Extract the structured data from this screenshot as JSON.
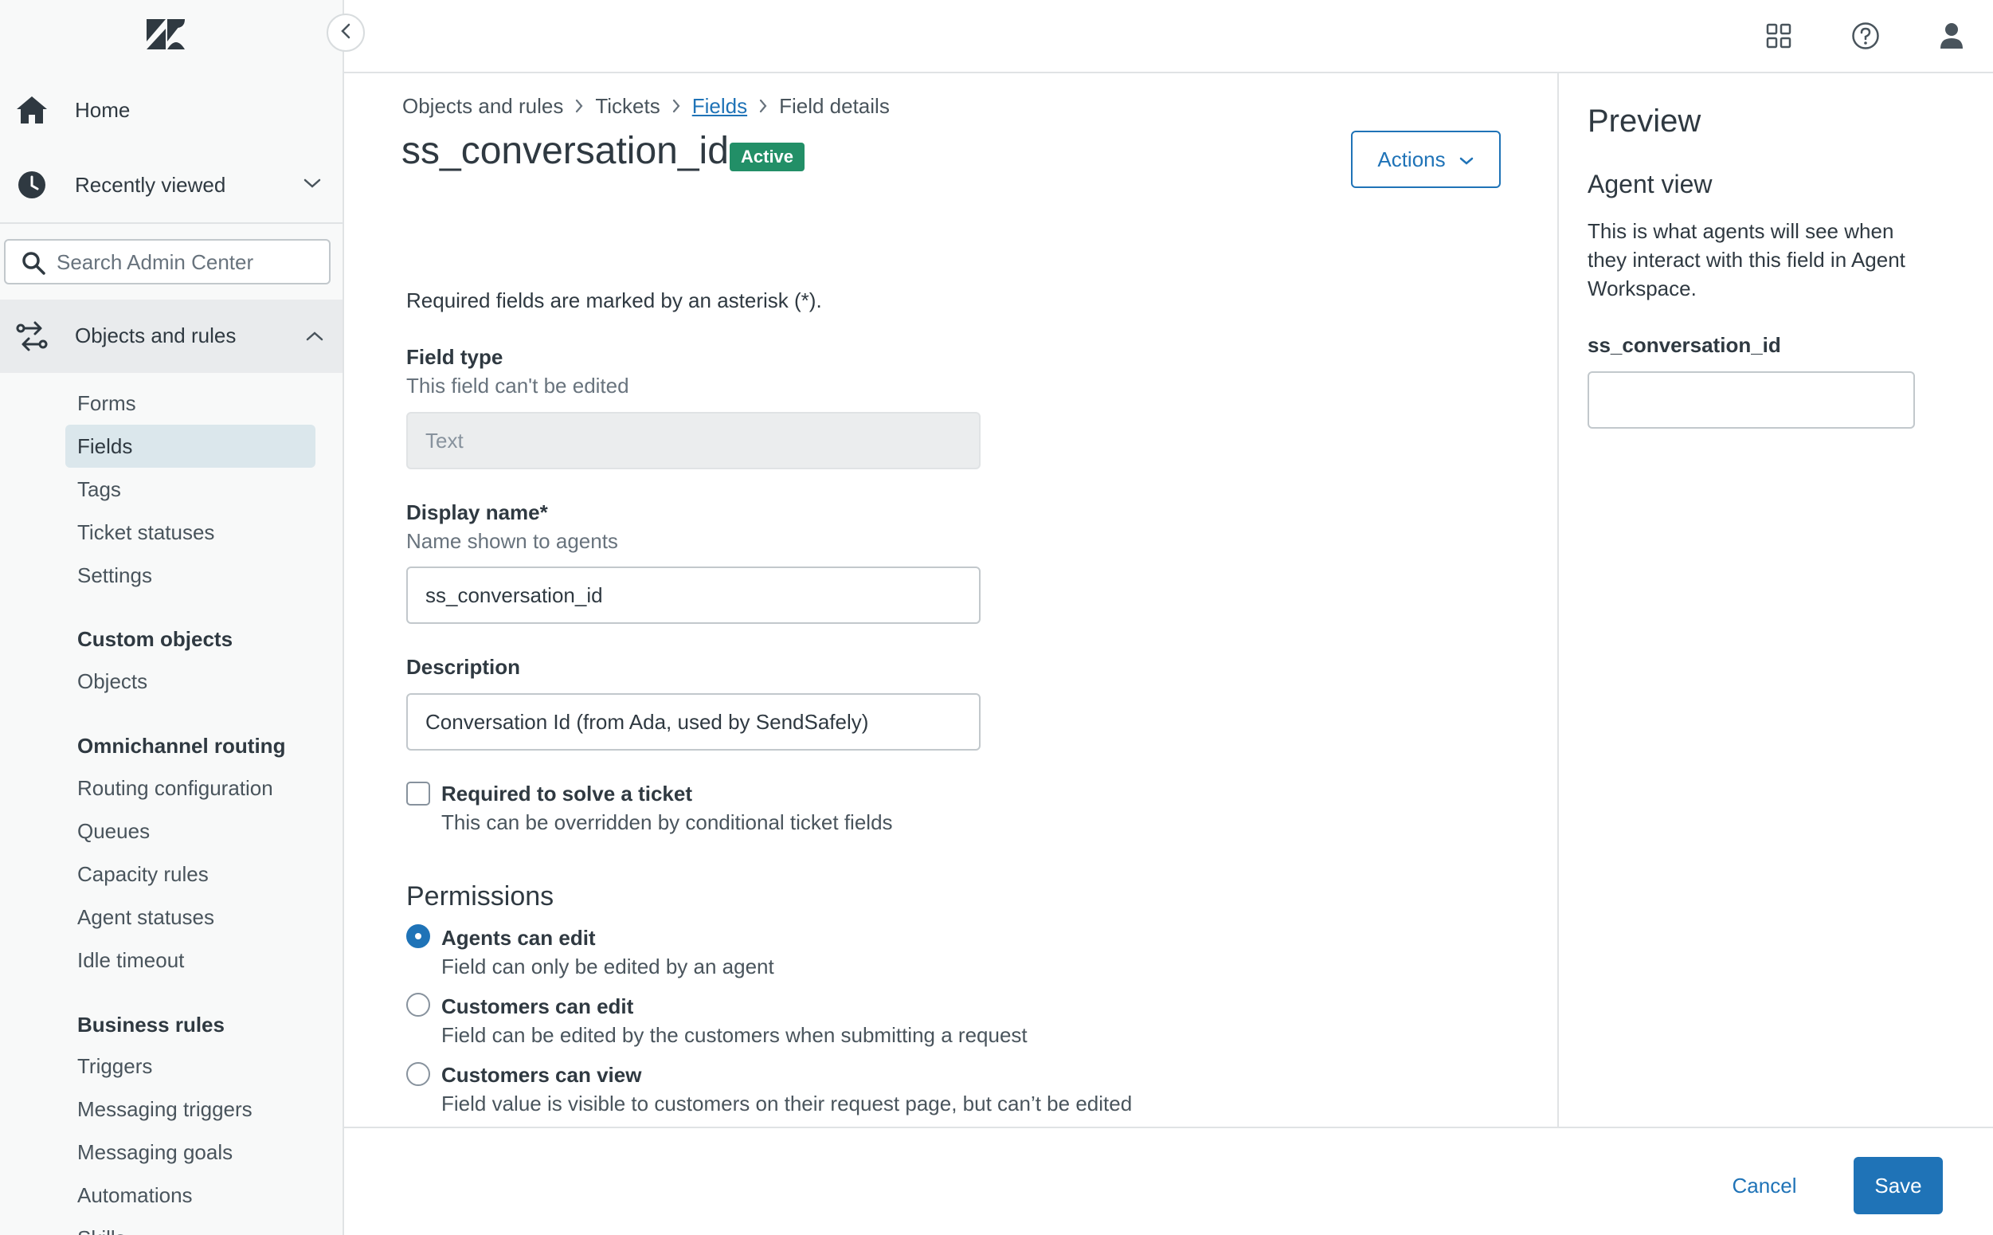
{
  "sidebar": {
    "home_label": "Home",
    "recent_label": "Recently viewed",
    "search_placeholder": "Search Admin Center",
    "objects_label": "Objects and rules",
    "items": [
      {
        "label": "Forms"
      },
      {
        "label": "Fields"
      },
      {
        "label": "Tags"
      },
      {
        "label": "Ticket statuses"
      },
      {
        "label": "Settings"
      }
    ],
    "custom_objects": {
      "heading": "Custom objects",
      "items": [
        {
          "label": "Objects"
        }
      ]
    },
    "omnichannel": {
      "heading": "Omnichannel routing",
      "items": [
        {
          "label": "Routing configuration"
        },
        {
          "label": "Queues"
        },
        {
          "label": "Capacity rules"
        },
        {
          "label": "Agent statuses"
        },
        {
          "label": "Idle timeout"
        }
      ]
    },
    "business_rules": {
      "heading": "Business rules",
      "items": [
        {
          "label": "Triggers"
        },
        {
          "label": "Messaging triggers"
        },
        {
          "label": "Messaging goals"
        },
        {
          "label": "Automations"
        },
        {
          "label": "Skills"
        }
      ]
    }
  },
  "breadcrumb": {
    "items": [
      "Objects and rules",
      "Tickets",
      "Fields",
      "Field details"
    ]
  },
  "page": {
    "title": "ss_conversation_id",
    "status": "Active",
    "actions_label": "Actions",
    "required_note": "Required fields are marked by an asterisk (*).",
    "field_type": {
      "label": "Field type",
      "hint": "This field can't be edited",
      "value": "Text"
    },
    "display_name": {
      "label": "Display name*",
      "hint": "Name shown to agents",
      "value": "ss_conversation_id"
    },
    "description": {
      "label": "Description",
      "value": "Conversation Id (from Ada, used by SendSafely)"
    },
    "required_solve": {
      "label": "Required to solve a ticket",
      "hint": "This can be overridden by conditional ticket fields",
      "checked": false
    },
    "permissions": {
      "title": "Permissions",
      "options": [
        {
          "label": "Agents can edit",
          "hint": "Field can only be edited by an agent",
          "selected": true
        },
        {
          "label": "Customers can edit",
          "hint": "Field can be edited by the customers when submitting a request",
          "selected": false
        },
        {
          "label": "Customers can view",
          "hint": "Field value is visible to customers on their request page, but can’t be edited",
          "selected": false
        }
      ]
    }
  },
  "preview": {
    "title": "Preview",
    "agent_view_title": "Agent view",
    "agent_view_desc": "This is what agents will see when they interact with this field in Agent Workspace.",
    "field_label": "ss_conversation_id",
    "field_value": ""
  },
  "footer": {
    "cancel_label": "Cancel",
    "save_label": "Save"
  },
  "colors": {
    "accent": "#1f73b7",
    "active_badge": "#228f67",
    "sidebar_bg": "#f8f9f9",
    "sidebar_active": "#dbe7ec",
    "logo": "#03363d"
  },
  "icons": {
    "logo": "zendesk-logo",
    "home": "home-icon",
    "recent": "clock-icon",
    "search": "search-icon",
    "objects": "objects-rules-icon",
    "apps": "grid-icon",
    "help": "help-icon",
    "profile": "user-icon"
  }
}
